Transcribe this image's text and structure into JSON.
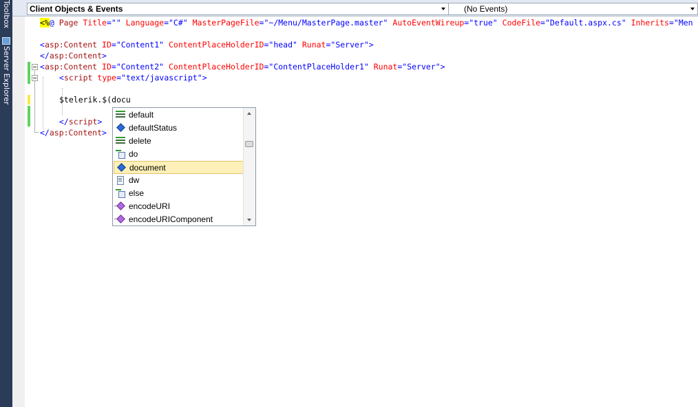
{
  "sidebar": {
    "toolbox_label": "Toolbox",
    "server_explorer_label": "Server Explorer"
  },
  "navbar": {
    "left_dropdown": "Client Objects & Events",
    "right_dropdown": "(No Events)"
  },
  "code": {
    "line1": {
      "open": "<%",
      "at": "@",
      "page": " Page",
      "title_attr": " Title",
      "title_val": "=\"\"",
      "lang_attr": " Language",
      "lang_val": "=\"C#\"",
      "mpf_attr": " MasterPageFile",
      "mpf_val": "=\"~/Menu/MasterPage.master\"",
      "aew_attr": " AutoEventWireup",
      "aew_val": "=\"true\"",
      "cf_attr": " CodeFile",
      "cf_val": "=\"Default.aspx.cs\"",
      "inh_attr": " Inherits",
      "inh_val": "=\"Men"
    },
    "line3": {
      "lt": "<",
      "tag": "asp:Content",
      "id_attr": " ID",
      "id_val": "=\"Content1\"",
      "cph_attr": " ContentPlaceHolderID",
      "cph_val": "=\"head\"",
      "runat_attr": " Runat",
      "runat_val": "=\"Server\"",
      "gt": ">"
    },
    "line4": {
      "lt": "</",
      "tag": "asp:Content",
      "gt": ">"
    },
    "line5": {
      "lt": "<",
      "tag": "asp:Content",
      "id_attr": " ID",
      "id_val": "=\"Content2\"",
      "cph_attr": " ContentPlaceHolderID",
      "cph_val": "=\"ContentPlaceHolder1\"",
      "runat_attr": " Runat",
      "runat_val": "=\"Server\"",
      "gt": ">"
    },
    "line6": {
      "lt": "<",
      "tag": "script",
      "type_attr": " type",
      "type_val": "=\"text/javascript\"",
      "gt": ">"
    },
    "line8": {
      "text": "$telerik.$(docu"
    },
    "line10": {
      "lt": "</",
      "tag": "script",
      "gt": ">"
    },
    "line11": {
      "lt": "</",
      "tag": "asp:Content",
      "gt": ">"
    }
  },
  "completion": {
    "items": [
      {
        "label": "default",
        "icon": "keyword-icon"
      },
      {
        "label": "defaultStatus",
        "icon": "property-icon"
      },
      {
        "label": "delete",
        "icon": "keyword-icon"
      },
      {
        "label": "do",
        "icon": "snippet-icon"
      },
      {
        "label": "document",
        "icon": "property-icon",
        "selected": true
      },
      {
        "label": "dw",
        "icon": "document-icon"
      },
      {
        "label": "else",
        "icon": "snippet-icon"
      },
      {
        "label": "encodeURI",
        "icon": "method-icon"
      },
      {
        "label": "encodeURIComponent",
        "icon": "method-icon"
      }
    ]
  }
}
